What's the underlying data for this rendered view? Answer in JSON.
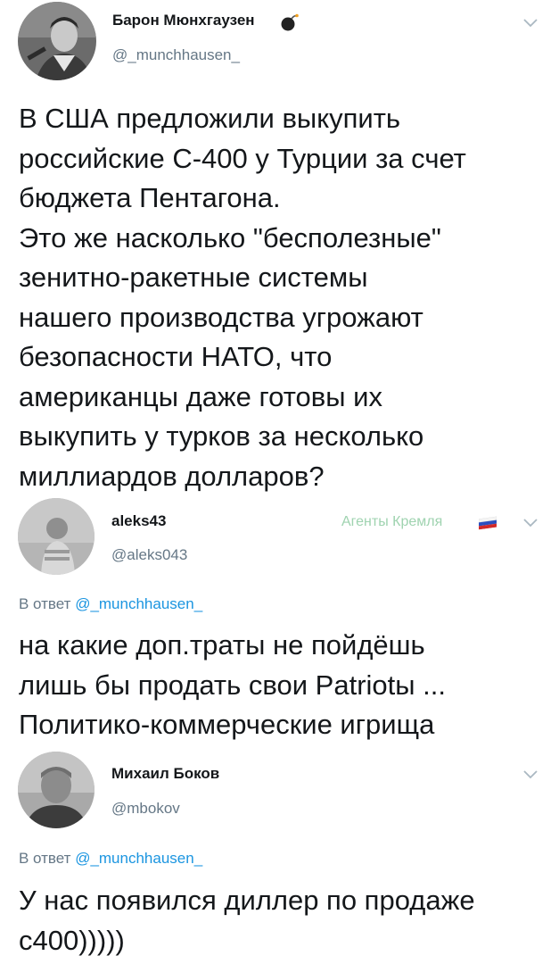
{
  "tweets": [
    {
      "display_name": "Барон Мюнхгаузен",
      "handle": "@_munchhausen_",
      "text": "В США предложили выкупить\nроссийские С-400 у Турции за счет\nбюджета Пентагона.\nЭто же насколько \"бесполезные\"\nзенитно-ракетные системы\nнашего производства угрожают\nбезопасности НАТО, что\nамериканцы даже готовы их\nвыкупить у турков за несколько\nмиллиардов долларов?",
      "name_badge": "bomb-icon"
    },
    {
      "display_name": "aleks43",
      "handle": "@aleks043",
      "affiliation": "Агенты Кремля",
      "affiliation_color": "#9fd3b0",
      "reply_prefix": "В ответ",
      "reply_mention": "@_munchhausen_",
      "text": "на какие доп.траты не пойдёшь\nлишь бы продать свои Patriotы ...\nПолитико-коммерческие игрища"
    },
    {
      "display_name": "Михаил Боков",
      "handle": "@mbokov",
      "reply_prefix": "В ответ",
      "reply_mention": "@_munchhausen_",
      "text": "У нас появился диллер по продаже\nс400)))))"
    }
  ],
  "colors": {
    "text": "#14171a",
    "secondary": "#657786",
    "link": "#1b95e0"
  }
}
